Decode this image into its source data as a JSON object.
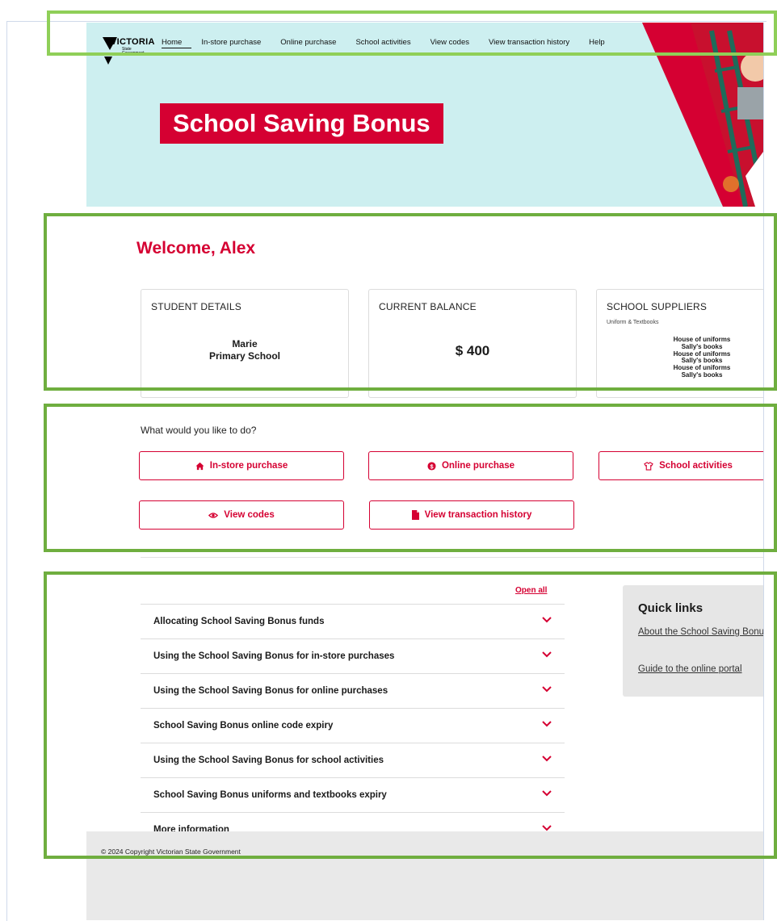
{
  "header": {
    "logo": {
      "brand": "VICTORIA",
      "sub": "State Government"
    },
    "nav": [
      "Home",
      "In-store purchase",
      "Online purchase",
      "School activities",
      "View codes",
      "View transaction history",
      "Help"
    ],
    "hero_title": "School Saving Bonus"
  },
  "welcome": "Welcome, Alex",
  "cards": {
    "student": {
      "header": "STUDENT DETAILS",
      "name": "Marie",
      "school": "Primary School"
    },
    "balance": {
      "header": "CURRENT BALANCE",
      "amount": "$ 400"
    },
    "suppliers": {
      "header": "SCHOOL SUPPLIERS",
      "category": "Uniform & Textbooks",
      "items": [
        "House of uniforms",
        "Sally's books",
        "House of uniforms",
        "Sally's books",
        "House of uniforms",
        "Sally's books"
      ]
    }
  },
  "actions": {
    "prompt": "What would you like to do?",
    "buttons": {
      "in_store": "In-store purchase",
      "online": "Online purchase",
      "activities": "School activities",
      "codes": "View codes",
      "history": "View transaction history"
    },
    "icons": {
      "in_store": "home-icon",
      "online": "dollar-circle-icon",
      "activities": "shirt-icon",
      "codes": "eye-icon",
      "history": "file-icon"
    }
  },
  "accordion": {
    "open_all": "Open all",
    "items": [
      "Allocating School Saving Bonus funds",
      "Using the School Saving Bonus for in-store purchases",
      "Using the School Saving Bonus for online purchases",
      "School Saving Bonus online code expiry",
      "Using the School Saving Bonus for school activities",
      "School Saving Bonus uniforms and textbooks expiry",
      "More information"
    ]
  },
  "quick_links": {
    "title": "Quick links",
    "links": [
      "About the School Saving Bonus",
      "Guide to the online portal"
    ]
  },
  "footer": {
    "copyright": "© 2024 Copyright Victorian State Government"
  },
  "colors": {
    "brand": "#d50032",
    "hero_bg": "#cdeff0",
    "highlight": "#6fae3f"
  }
}
